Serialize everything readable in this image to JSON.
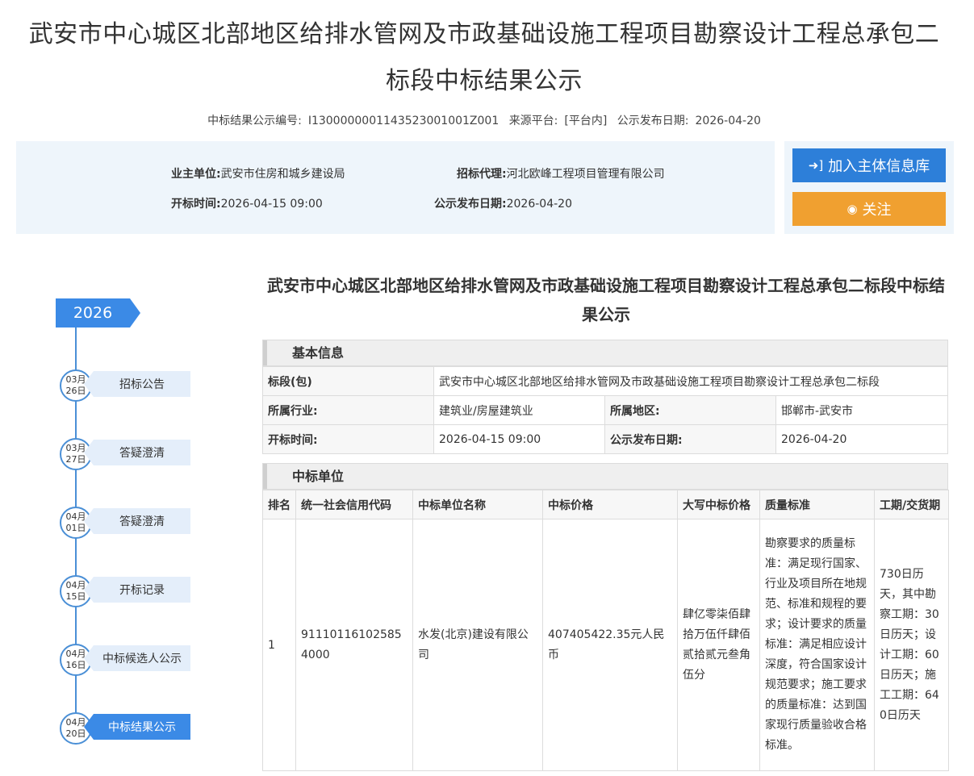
{
  "page": {
    "title": "武安市中心城区北部地区给排水管网及市政基础设施工程项目勘察设计工程总承包二标段中标结果公示",
    "meta": {
      "code_label": "中标结果公示编号:",
      "code_value": "I1300000001143523001001Z001",
      "source_label": "来源平台:",
      "source_value": "[平台内]",
      "publish_label": "公示发布日期:",
      "publish_value": "2026-04-20"
    }
  },
  "info": {
    "owner_label": "业主单位:",
    "owner_value": "武安市住房和城乡建设局",
    "agent_label": "招标代理:",
    "agent_value": "河北欧峰工程项目管理有限公司",
    "open_label": "开标时间:",
    "open_value": "2026-04-15 09:00",
    "publish_label": "公示发布日期:",
    "publish_value": "2026-04-20"
  },
  "actions": {
    "add_label": "加入主体信息库",
    "follow_label": "关注"
  },
  "timeline": {
    "year": "2026",
    "items": [
      {
        "month": "03月",
        "day": "26日",
        "label": "招标公告"
      },
      {
        "month": "03月",
        "day": "27日",
        "label": "答疑澄清"
      },
      {
        "month": "04月",
        "day": "01日",
        "label": "答疑澄清"
      },
      {
        "month": "04月",
        "day": "15日",
        "label": "开标记录"
      },
      {
        "month": "04月",
        "day": "16日",
        "label": "中标候选人公示"
      },
      {
        "month": "04月",
        "day": "20日",
        "label": "中标结果公示"
      }
    ]
  },
  "content": {
    "title": "武安市中心城区北部地区给排水管网及市政基础设施工程项目勘察设计工程总承包二标段中标结果公示",
    "basic": {
      "heading": "基本信息",
      "section_label": "标段(包)",
      "section_value": "武安市中心城区北部地区给排水管网及市政基础设施工程项目勘察设计工程总承包二标段",
      "industry_label": "所属行业:",
      "industry_value": "建筑业/房屋建筑业",
      "region_label": "所属地区:",
      "region_value": "邯郸市-武安市",
      "open_label": "开标时间:",
      "open_value": "2026-04-15 09:00",
      "publish_label": "公示发布日期:",
      "publish_value": "2026-04-20"
    },
    "winner": {
      "heading": "中标单位",
      "columns": [
        "排名",
        "统一社会信用代码",
        "中标单位名称",
        "中标价格",
        "大写中标价格",
        "质量标准",
        "工期/交货期"
      ],
      "rows": [
        {
          "rank": "1",
          "credit_code": "911101161025854000",
          "name": "水发(北京)建设有限公司",
          "price": "407405422.35元人民币",
          "price_upper": "肆亿零柒佰肆拾万伍仟肆佰贰拾贰元叁角伍分",
          "quality": "勘察要求的质量标准：满足现行国家、行业及项目所在地规范、标准和规程的要求；设计要求的质量标准：满足相应设计深度，符合国家设计规范要求；施工要求的质量标准：达到国家现行质量验收合格标准。",
          "period": "730日历天，其中勘察工期：30日历天；设计工期：60日历天；施工工期：640日历天"
        }
      ]
    }
  }
}
